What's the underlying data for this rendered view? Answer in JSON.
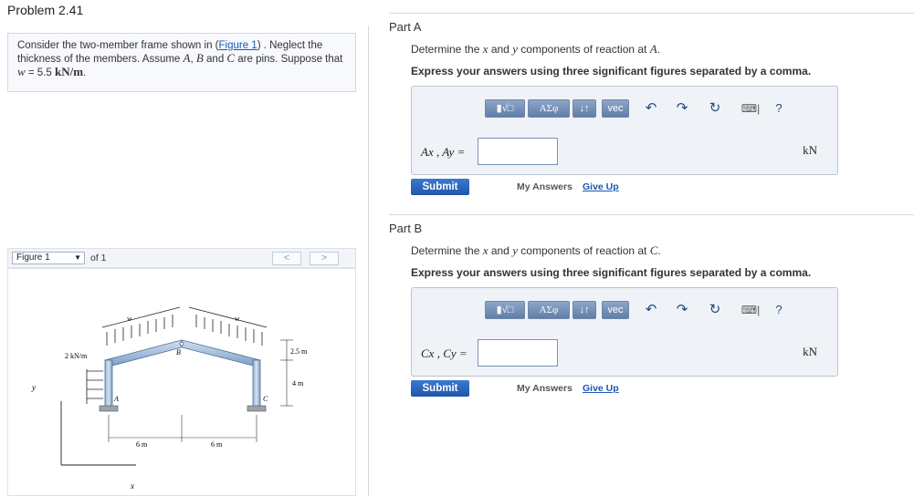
{
  "page": {
    "title": "Problem 2.41"
  },
  "problem": {
    "text_1": "Consider the two-member frame shown in (",
    "figure_link": "Figure 1",
    "text_2": ") . Neglect the thickness of the members. Assume ",
    "A": "A",
    "sep1": ", ",
    "B": "B",
    "and_text": " and ",
    "C": "C",
    "text_3": " are pins. Suppose that ",
    "w_sym": "w",
    "eq_value": " = 5.5 ",
    "unit": "kN/m",
    "end": "."
  },
  "figure_nav": {
    "select_value": "Figure 1",
    "of_text": "of 1",
    "prev_label": "<",
    "next_label": ">"
  },
  "figure": {
    "load_w_left": "w",
    "load_w_right": "w",
    "side_load": "2 kN/m",
    "label_A": "A",
    "label_B": "B",
    "label_C": "C",
    "dim_rise": "2.5 m",
    "dim_height": "4 m",
    "dim_left": "6 m",
    "dim_right": "6 m",
    "axis_x": "x",
    "axis_y": "y"
  },
  "toolbar": {
    "templates": "▮√□",
    "greek": "ΑΣφ",
    "arrows": "↓↑",
    "vec": "vec",
    "help": "?"
  },
  "parts": [
    {
      "label": "Part A",
      "prompt_1": "Determine the ",
      "x": "x",
      "and": " and ",
      "y": "y",
      "prompt_2": " components of reaction at ",
      "point": "A",
      "end": ".",
      "instruction": "Express your answers using three significant figures separated by a comma.",
      "answer_label": "Ax , Ay =",
      "answer_value": "",
      "unit": "kN",
      "submit": "Submit",
      "my_answers": "My Answers",
      "give_up": "Give Up"
    },
    {
      "label": "Part B",
      "prompt_1": "Determine the ",
      "x": "x",
      "and": " and ",
      "y": "y",
      "prompt_2": " components of reaction at ",
      "point": "C",
      "end": ".",
      "instruction": "Express your answers using three significant figures separated by a comma.",
      "answer_label": "Cx , Cy =",
      "answer_value": "",
      "unit": "kN",
      "submit": "Submit",
      "my_answers": "My Answers",
      "give_up": "Give Up"
    }
  ]
}
